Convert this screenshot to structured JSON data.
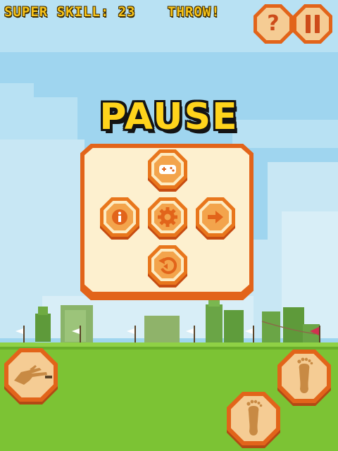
{
  "hud": {
    "super_skill": "SUPER SKILL: 23",
    "throw": "THROW!"
  },
  "top_buttons": {
    "help_label": "?",
    "help_icon": "question-mark-icon",
    "pause_icon": "pause-icon"
  },
  "pause_menu": {
    "title": "PAUSE",
    "buttons": [
      {
        "name": "more-games",
        "icon": "gamepad-icon"
      },
      {
        "name": "info",
        "icon": "info-icon"
      },
      {
        "name": "settings",
        "icon": "gear-icon"
      },
      {
        "name": "resume",
        "icon": "arrow-right-icon"
      },
      {
        "name": "restart",
        "icon": "restart-icon"
      }
    ]
  },
  "controls": {
    "throw_hand_icon": "hand-icon",
    "left_foot_icon": "footprint-icon",
    "right_foot_icon": "footprint-icon"
  },
  "colors": {
    "sky": "#9fd5ef",
    "grass": "#7cc334",
    "title_yellow": "#ffd41c",
    "button_orange": "#e2641a",
    "panel_cream": "#fdf0cf"
  }
}
